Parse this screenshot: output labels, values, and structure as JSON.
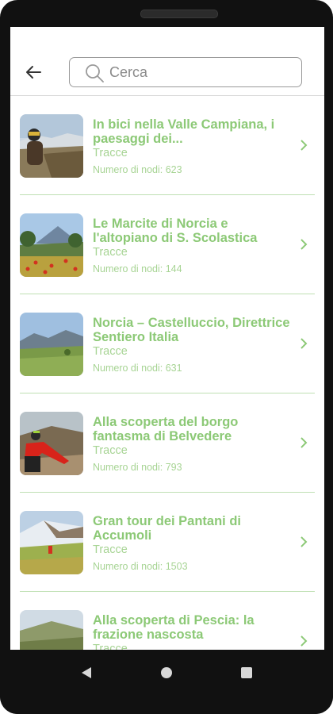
{
  "search": {
    "placeholder": "Cerca",
    "value": ""
  },
  "items": [
    {
      "title": "In bici nella Valle Campiana, i paesaggi dei...",
      "category": "Tracce",
      "nodes": "Numero di nodi: 623"
    },
    {
      "title": "Le Marcite di Norcia e l'altopiano di S. Scolastica",
      "category": "Tracce",
      "nodes": "Numero di nodi: 144"
    },
    {
      "title": "Norcia – Castelluccio, Direttrice Sentiero Italia",
      "category": "Tracce",
      "nodes": "Numero di nodi: 631"
    },
    {
      "title": "Alla scoperta del borgo fantasma di Belvedere",
      "category": "Tracce",
      "nodes": "Numero di nodi: 793"
    },
    {
      "title": "Gran tour dei Pantani di Accumoli",
      "category": "Tracce",
      "nodes": "Numero di nodi: 1503"
    },
    {
      "title": "Alla scoperta di Pescia: la frazione nascosta",
      "category": "Tracce",
      "nodes": ""
    }
  ],
  "icons": {
    "back": "arrow-left-icon",
    "search": "search-icon",
    "chevron": "chevron-right-icon",
    "nav_back": "triangle-back-icon",
    "nav_home": "circle-home-icon",
    "nav_recents": "square-recents-icon"
  },
  "colors": {
    "accent": "#8cc976",
    "accent_light": "#a7d494",
    "divider": "#bfe0b3"
  }
}
